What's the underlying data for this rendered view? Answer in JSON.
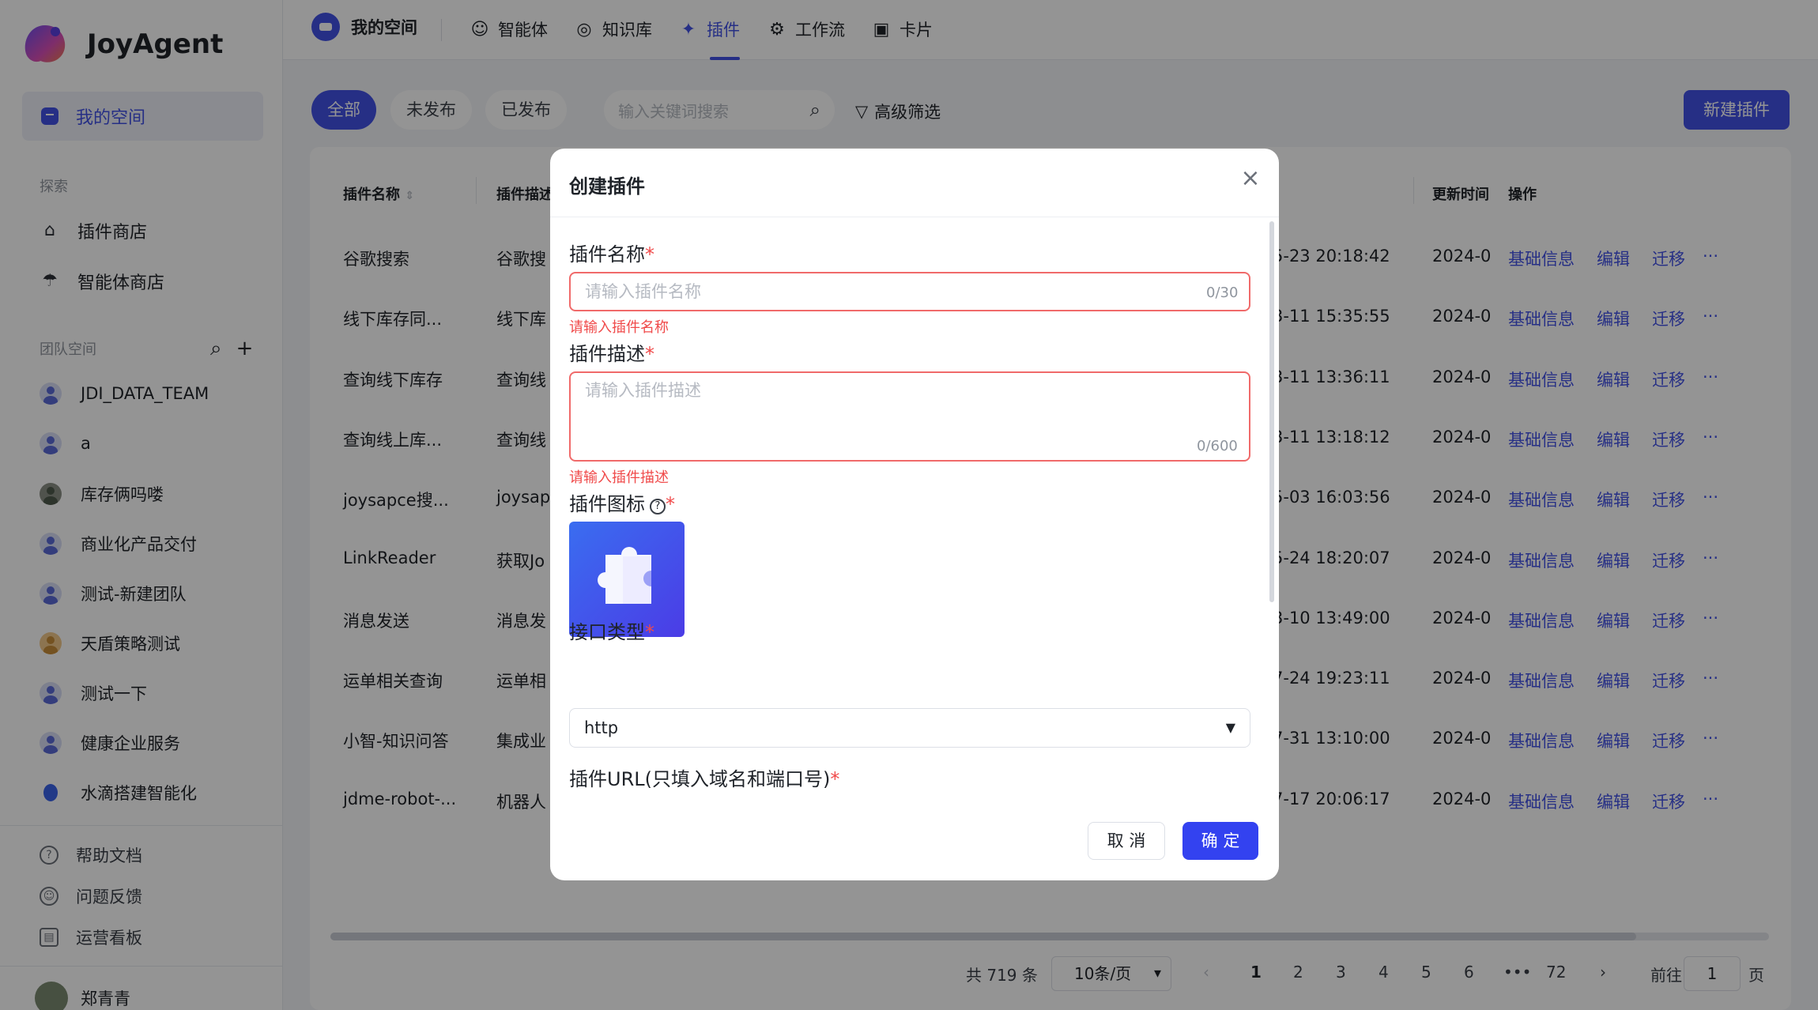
{
  "app": {
    "name": "JoyAgent"
  },
  "sidebar": {
    "my_space": "我的空间",
    "explore_label": "探索",
    "explore_items": [
      {
        "label": "插件商店",
        "icon": "store-icon"
      },
      {
        "label": "智能体商店",
        "icon": "agent-store-icon"
      }
    ],
    "team_label": "团队空间",
    "teams": [
      "JDI_DATA_TEAM",
      "a",
      "库存俩吗喽",
      "商业化产品交付",
      "测试-新建团队",
      "天盾策略测试",
      "测试一下",
      "健康企业服务",
      "水滴搭建智能化"
    ],
    "footer": [
      "帮助文档",
      "问题反馈",
      "运营看板"
    ],
    "user": "郑青青"
  },
  "topnav": {
    "space": "我的空间",
    "tabs": [
      {
        "label": "智能体",
        "icon": "agent-icon"
      },
      {
        "label": "知识库",
        "icon": "knowledge-icon"
      },
      {
        "label": "插件",
        "icon": "plugin-icon",
        "active": true
      },
      {
        "label": "工作流",
        "icon": "workflow-icon"
      },
      {
        "label": "卡片",
        "icon": "card-icon"
      }
    ]
  },
  "filters": {
    "chips": [
      "全部",
      "未发布",
      "已发布"
    ],
    "search_placeholder": "输入关键词搜索",
    "advanced": "高级筛选",
    "new_button": "新建插件"
  },
  "table": {
    "headers": {
      "name": "插件名称",
      "desc": "插件描述",
      "update": "更新时间",
      "ops": "操作"
    },
    "rows": [
      {
        "name": "谷歌搜索",
        "desc": "谷歌搜",
        "created": "5-23 20:18:42",
        "update": "2024-0"
      },
      {
        "name": "线下库存同...",
        "desc": "线下库",
        "created": "3-11 15:35:55",
        "update": "2024-0"
      },
      {
        "name": "查询线下库存",
        "desc": "查询线",
        "created": "3-11 13:36:11",
        "update": "2024-0"
      },
      {
        "name": "查询线上库...",
        "desc": "查询线",
        "created": "3-11 13:18:12",
        "update": "2024-0"
      },
      {
        "name": "joysapce搜...",
        "desc": "joysap",
        "created": "5-03 16:03:56",
        "update": "2024-0"
      },
      {
        "name": "LinkReader",
        "desc": "获取Jo",
        "created": "5-24 18:20:07",
        "update": "2024-0"
      },
      {
        "name": "消息发送",
        "desc": "消息发",
        "created": "3-10 13:49:00",
        "update": "2024-0"
      },
      {
        "name": "运单相关查询",
        "desc": "运单相",
        "created": "7-24 19:23:11",
        "update": "2024-0"
      },
      {
        "name": "小智-知识问答",
        "desc": "集成业",
        "created": "7-31 13:10:00",
        "update": "2024-0"
      },
      {
        "name": "jdme-robot-...",
        "desc": "机器人",
        "created": "7-17 20:06:17",
        "update": "2024-0"
      }
    ],
    "ops": [
      "基础信息",
      "编辑",
      "迁移",
      "···"
    ]
  },
  "pagination": {
    "total": "共 719 条",
    "page_size": "10条/页",
    "pages": [
      "1",
      "2",
      "3",
      "4",
      "5",
      "6",
      "•••",
      "72"
    ],
    "current": "1",
    "goto_prefix": "前往",
    "goto_value": "1",
    "goto_suffix": "页"
  },
  "modal": {
    "title": "创建插件",
    "name_label": "插件名称",
    "name_placeholder": "请输入插件名称",
    "name_counter": "0/30",
    "name_error": "请输入插件名称",
    "desc_label": "插件描述",
    "desc_placeholder": "请输入插件描述",
    "desc_counter": "0/600",
    "desc_error": "请输入插件描述",
    "icon_label": "插件图标",
    "type_label": "接口类型",
    "type_value": "http",
    "url_label": "插件URL(只填入域名和端口号)",
    "required_mark": "*",
    "cancel": "取 消",
    "confirm": "确 定"
  },
  "colors": {
    "accent": "#4251e6",
    "error": "#f04a4a",
    "overlay": "rgba(0,0,0,0.42)"
  }
}
